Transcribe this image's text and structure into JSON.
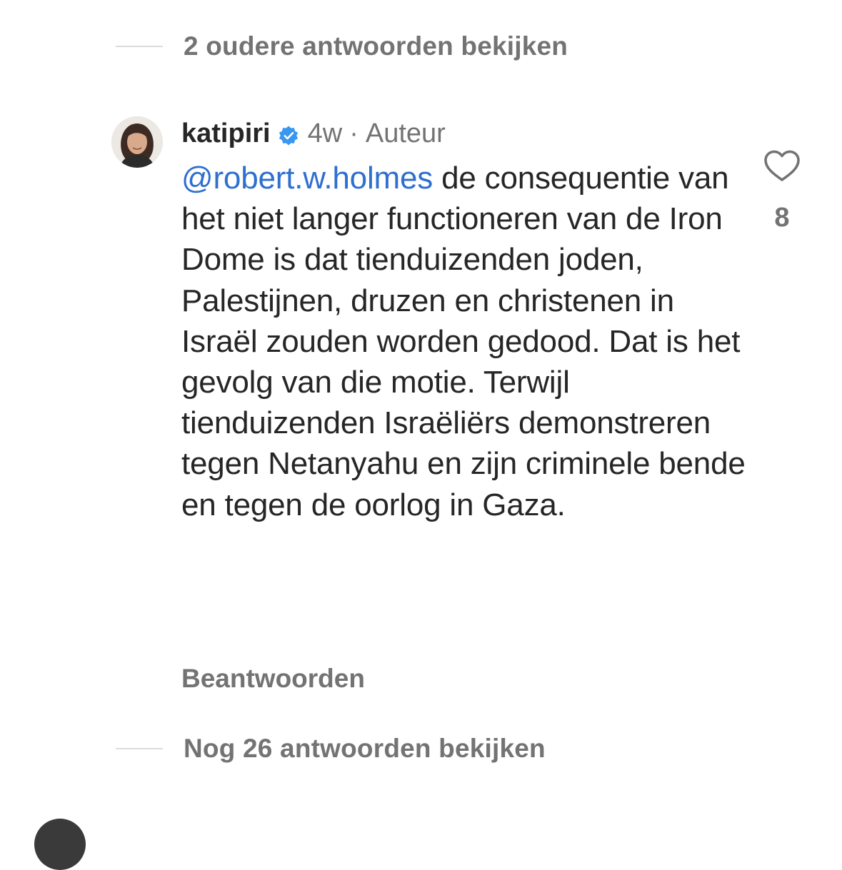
{
  "older_replies": {
    "label": "2 oudere antwoorden bekijken"
  },
  "comment": {
    "username": "katipiri",
    "verified": true,
    "time": "4w",
    "separator": "·",
    "author_label": "Auteur",
    "mention": "@robert.w.holmes",
    "text": " de consequentie van het niet langer functioneren van de Iron Dome is dat tienduizenden joden, Palestijnen, druzen en christenen in Israël zouden worden gedood. Dat is het gevolg van die motie. Terwijl tienduizenden Israëliërs demonstreren tegen Netanyahu en zijn criminele bende en tegen de oorlog in Gaza.",
    "like_count": "8",
    "reply_label": "Beantwoorden"
  },
  "more_replies": {
    "label": "Nog 26 antwoorden bekijken"
  },
  "icons": {
    "verified": "verified-badge-icon",
    "like": "heart-outline-icon"
  },
  "colors": {
    "mention": "#2e6fcf",
    "verified": "#3897f0",
    "secondary_text": "#737373"
  }
}
